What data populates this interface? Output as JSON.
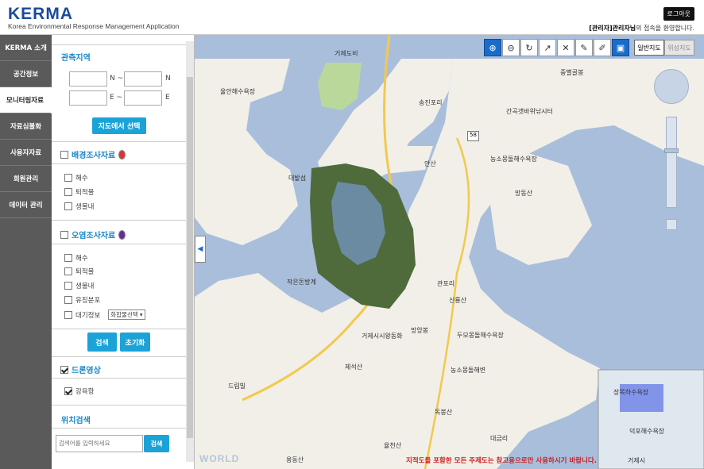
{
  "header": {
    "logo": "KERMA",
    "subtitle": "Korea Environmental Response Management Application",
    "logout": "로그아웃",
    "welcome_role": "[관리자]관리자님",
    "welcome_msg": "의 접속을 환영합니다."
  },
  "nav": [
    "KERMA 소개",
    "공간정보",
    "모니터링자료",
    "자료심볼화",
    "사용자자료",
    "회원관리",
    "데이터 관리"
  ],
  "panel": {
    "region_title": "관측지역",
    "n_sep": "N ~",
    "n_suffix": "N",
    "e_sep": "E ~",
    "e_suffix": "E",
    "map_select_btn": "지도에서 선택",
    "bg_survey": "배경조사자료",
    "bg_items": [
      "해수",
      "퇴적물",
      "생물내"
    ],
    "pollution_survey": "오염조사자료",
    "pollution_items": [
      "해수",
      "퇴적물",
      "생물내",
      "유징분포",
      "대기정보"
    ],
    "air_select": "화합물선택",
    "search_btn": "검색",
    "reset_btn": "초기화",
    "drone": "드론영상",
    "drone_item": "강욕항",
    "location_title": "위치검색",
    "search_placeholder": "검색어를 입력하세요",
    "search_go": "검색"
  },
  "map": {
    "normal_map": "일반지도",
    "satellite_map": "위성지도",
    "disclaimer": "지적도를 포함한 모든 주제도는 참고용으로만 사용하시기 바랍니다.",
    "road_num": "58",
    "watermark": "WORLD",
    "labels": [
      "거제도비",
      "율안해수욕장",
      "송진포리",
      "중별골봉",
      "간곡갯바위낚시터",
      "대밭섬",
      "안산",
      "농소몽돌해수욕장",
      "망동산",
      "작은돈방계",
      "관포리",
      "신룡산",
      "망앙봉",
      "거제시시왕동화",
      "두모몽돌해수욕장",
      "제석산",
      "농소몽돌해변",
      "드림빌",
      "독봉산",
      "율천산",
      "용동산",
      "대금리",
      "장목하수욕장",
      "덕포해수욕장",
      "거제시"
    ]
  },
  "colors": {
    "nav_bg": "#5a5a5a",
    "accent": "#1ba3d8",
    "logo": "#1a4a9c",
    "sea": "#a9bedb",
    "land": "#f1efe8",
    "active_tool": "#1a6ccc"
  }
}
